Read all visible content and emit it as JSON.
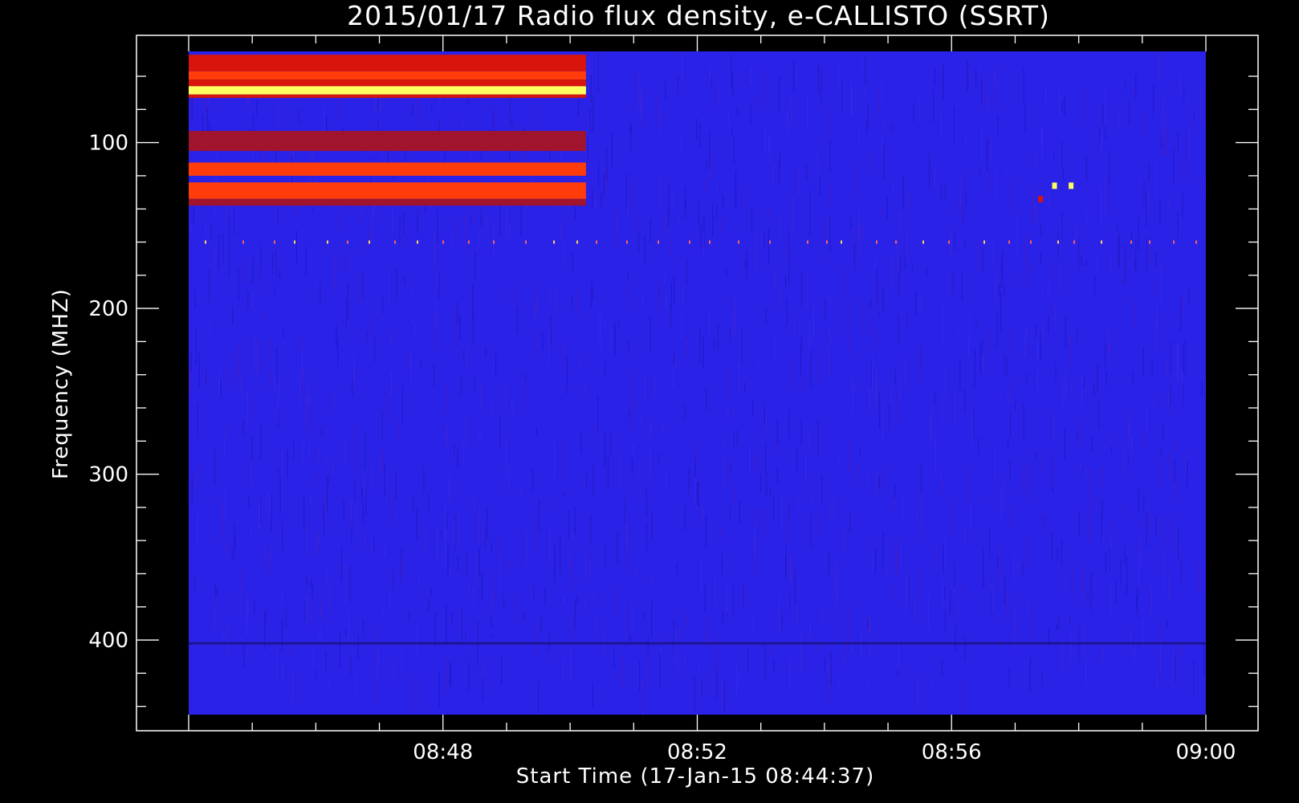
{
  "chart_data": {
    "type": "heatmap",
    "title": "2015/01/17  Radio flux density, e-CALLISTO (SSRT)",
    "xlabel": "Start Time (17-Jan-15 08:44:37)",
    "ylabel": "Frequency (MHZ)",
    "x_range_minutes": [
      8.0,
      24.0
    ],
    "y_range_mhz": [
      45,
      445
    ],
    "y_inverted": true,
    "x_tick_labels": [
      {
        "minute": 12,
        "label": "08:48"
      },
      {
        "minute": 16,
        "label": "08:52"
      },
      {
        "minute": 20,
        "label": "08:56"
      },
      {
        "minute": 24,
        "label": "09:00"
      }
    ],
    "y_tick_labels": [
      {
        "value": 100,
        "label": "100"
      },
      {
        "value": 200,
        "label": "200"
      },
      {
        "value": 300,
        "label": "300"
      },
      {
        "value": 400,
        "label": "400"
      }
    ],
    "background_color": "#2a22e6",
    "bright_bands": [
      {
        "x_minute_start": 8.0,
        "x_minute_end": 14.25,
        "freq_start_mhz": 47,
        "freq_end_mhz": 57,
        "level": "medium"
      },
      {
        "x_minute_start": 8.0,
        "x_minute_end": 14.25,
        "freq_start_mhz": 57,
        "freq_end_mhz": 62,
        "level": "high"
      },
      {
        "x_minute_start": 8.0,
        "x_minute_end": 14.25,
        "freq_start_mhz": 62,
        "freq_end_mhz": 66,
        "level": "medium"
      },
      {
        "x_minute_start": 8.0,
        "x_minute_end": 14.25,
        "freq_start_mhz": 66,
        "freq_end_mhz": 71,
        "level": "very-high"
      },
      {
        "x_minute_start": 8.0,
        "x_minute_end": 14.25,
        "freq_start_mhz": 71,
        "freq_end_mhz": 73,
        "level": "medium"
      },
      {
        "x_minute_start": 8.0,
        "x_minute_end": 14.25,
        "freq_start_mhz": 93,
        "freq_end_mhz": 105,
        "level": "low"
      },
      {
        "x_minute_start": 8.0,
        "x_minute_end": 14.25,
        "freq_start_mhz": 112,
        "freq_end_mhz": 120,
        "level": "high"
      },
      {
        "x_minute_start": 8.0,
        "x_minute_end": 14.25,
        "freq_start_mhz": 124,
        "freq_end_mhz": 134,
        "level": "high"
      },
      {
        "x_minute_start": 8.0,
        "x_minute_end": 14.25,
        "freq_start_mhz": 134,
        "freq_end_mhz": 138,
        "level": "low"
      }
    ],
    "hot_spots": [
      {
        "x_minute": 21.62,
        "freq_mhz": 126,
        "level": "very-high"
      },
      {
        "x_minute": 21.88,
        "freq_mhz": 126,
        "level": "very-high"
      },
      {
        "x_minute": 21.4,
        "freq_mhz": 134,
        "level": "medium"
      }
    ],
    "interference_line_mhz": 160,
    "dark_line_mhz": 402,
    "color_levels": {
      "low": "#a0142e",
      "medium": "#d8140c",
      "high": "#ff3c0a",
      "very-high": "#ffff60"
    }
  }
}
